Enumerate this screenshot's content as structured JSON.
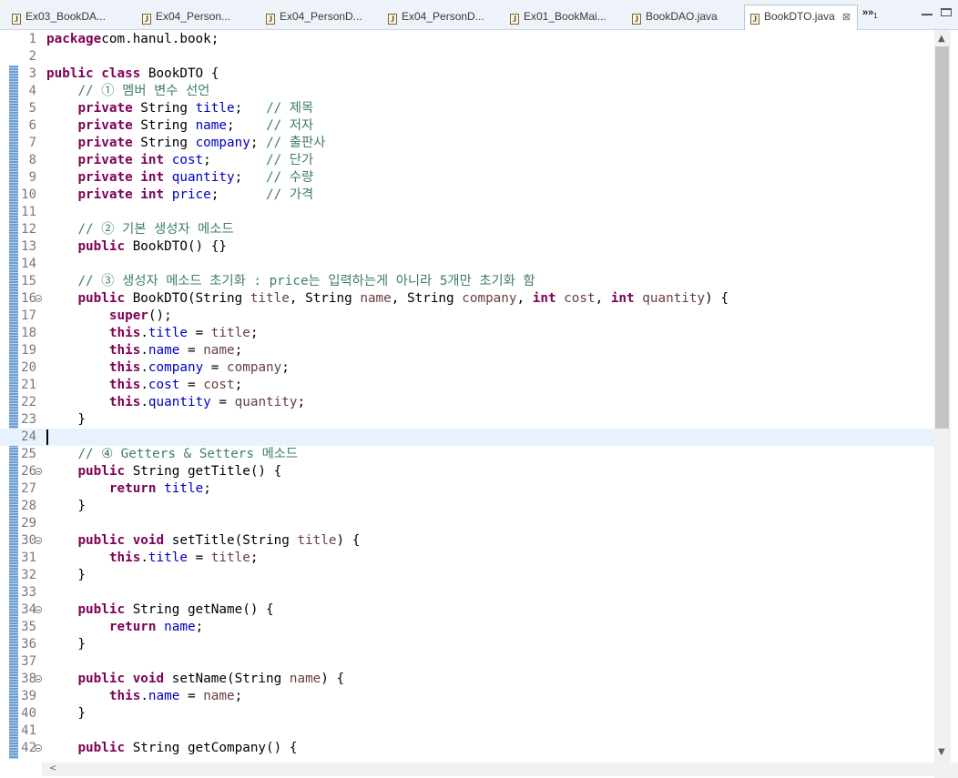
{
  "tabs": [
    {
      "label": "Ex03_BookDA...",
      "active": false
    },
    {
      "label": "Ex04_Person...",
      "active": false
    },
    {
      "label": "Ex04_PersonD...",
      "active": false
    },
    {
      "label": "Ex04_PersonD...",
      "active": false
    },
    {
      "label": "Ex01_BookMai...",
      "active": false
    },
    {
      "label": "BookDAO.java",
      "active": false
    },
    {
      "label": "BookDTO.java",
      "active": true
    }
  ],
  "tab_overflow": {
    "symbol": "»",
    "count": "1"
  },
  "icons": {
    "file": "java-file-icon",
    "close": "close-x-icon",
    "fold": "fold-collapse-icon"
  },
  "editor": {
    "current_line": 24,
    "lines": [
      {
        "n": "1",
        "t": [
          [
            "kw",
            "package"
          ],
          [
            "",
            "com.hanul.book;"
          ]
        ]
      },
      {
        "n": "2",
        "t": []
      },
      {
        "n": "3",
        "t": [
          [
            "kw",
            "public class"
          ],
          [
            "",
            " BookDTO {"
          ]
        ]
      },
      {
        "n": "4",
        "t": [
          [
            "",
            "    "
          ],
          [
            "cmt",
            "// ① 멤버 변수 선언"
          ]
        ]
      },
      {
        "n": "5",
        "t": [
          [
            "",
            "    "
          ],
          [
            "kw",
            "private"
          ],
          [
            "",
            " String "
          ],
          [
            "fld",
            "title"
          ],
          [
            "",
            ";   "
          ],
          [
            "cmt",
            "// 제목"
          ]
        ]
      },
      {
        "n": "6",
        "t": [
          [
            "",
            "    "
          ],
          [
            "kw",
            "private"
          ],
          [
            "",
            " String "
          ],
          [
            "fld",
            "name"
          ],
          [
            "",
            ";    "
          ],
          [
            "cmt",
            "// 저자"
          ]
        ]
      },
      {
        "n": "7",
        "t": [
          [
            "",
            "    "
          ],
          [
            "kw",
            "private"
          ],
          [
            "",
            " String "
          ],
          [
            "fld",
            "company"
          ],
          [
            "",
            "; "
          ],
          [
            "cmt",
            "// 출판사"
          ]
        ]
      },
      {
        "n": "8",
        "t": [
          [
            "",
            "    "
          ],
          [
            "kw",
            "private int"
          ],
          [
            "",
            " "
          ],
          [
            "fld",
            "cost"
          ],
          [
            "",
            ";       "
          ],
          [
            "cmt",
            "// 단가"
          ]
        ]
      },
      {
        "n": "9",
        "t": [
          [
            "",
            "    "
          ],
          [
            "kw",
            "private int"
          ],
          [
            "",
            " "
          ],
          [
            "fld",
            "quantity"
          ],
          [
            "",
            ";   "
          ],
          [
            "cmt",
            "// 수량"
          ]
        ]
      },
      {
        "n": "10",
        "t": [
          [
            "",
            "    "
          ],
          [
            "kw",
            "private int"
          ],
          [
            "",
            " "
          ],
          [
            "fld",
            "price"
          ],
          [
            "",
            ";      "
          ],
          [
            "cmt",
            "// 가격"
          ]
        ]
      },
      {
        "n": "11",
        "t": []
      },
      {
        "n": "12",
        "t": [
          [
            "",
            "    "
          ],
          [
            "cmt",
            "// ② 기본 생성자 메소드"
          ]
        ]
      },
      {
        "n": "13",
        "t": [
          [
            "",
            "    "
          ],
          [
            "kw",
            "public"
          ],
          [
            "",
            " BookDTO() {}"
          ]
        ]
      },
      {
        "n": "14",
        "t": []
      },
      {
        "n": "15",
        "t": [
          [
            "",
            "    "
          ],
          [
            "cmt",
            "// ③ 생성자 메소드 초기화 : price는 입력하는게 아니라 5개만 초기화 함"
          ]
        ]
      },
      {
        "n": "16",
        "fold": true,
        "t": [
          [
            "",
            "    "
          ],
          [
            "kw",
            "public"
          ],
          [
            "",
            " BookDTO(String "
          ],
          [
            "param",
            "title"
          ],
          [
            "",
            ", String "
          ],
          [
            "param",
            "name"
          ],
          [
            "",
            ", String "
          ],
          [
            "param",
            "company"
          ],
          [
            "",
            ", "
          ],
          [
            "kw",
            "int"
          ],
          [
            "",
            " "
          ],
          [
            "param",
            "cost"
          ],
          [
            "",
            ", "
          ],
          [
            "kw",
            "int"
          ],
          [
            "",
            " "
          ],
          [
            "param",
            "quantity"
          ],
          [
            "",
            ") {"
          ]
        ]
      },
      {
        "n": "17",
        "t": [
          [
            "",
            "        "
          ],
          [
            "kw",
            "super"
          ],
          [
            "",
            "();"
          ]
        ]
      },
      {
        "n": "18",
        "t": [
          [
            "",
            "        "
          ],
          [
            "kw",
            "this"
          ],
          [
            "",
            "."
          ],
          [
            "fld",
            "title"
          ],
          [
            "",
            " = "
          ],
          [
            "param",
            "title"
          ],
          [
            "",
            ";"
          ]
        ]
      },
      {
        "n": "19",
        "t": [
          [
            "",
            "        "
          ],
          [
            "kw",
            "this"
          ],
          [
            "",
            "."
          ],
          [
            "fld",
            "name"
          ],
          [
            "",
            " = "
          ],
          [
            "param",
            "name"
          ],
          [
            "",
            ";"
          ]
        ]
      },
      {
        "n": "20",
        "t": [
          [
            "",
            "        "
          ],
          [
            "kw",
            "this"
          ],
          [
            "",
            "."
          ],
          [
            "fld",
            "company"
          ],
          [
            "",
            " = "
          ],
          [
            "param",
            "company"
          ],
          [
            "",
            ";"
          ]
        ]
      },
      {
        "n": "21",
        "t": [
          [
            "",
            "        "
          ],
          [
            "kw",
            "this"
          ],
          [
            "",
            "."
          ],
          [
            "fld",
            "cost"
          ],
          [
            "",
            " = "
          ],
          [
            "param",
            "cost"
          ],
          [
            "",
            ";"
          ]
        ]
      },
      {
        "n": "22",
        "t": [
          [
            "",
            "        "
          ],
          [
            "kw",
            "this"
          ],
          [
            "",
            "."
          ],
          [
            "fld",
            "quantity"
          ],
          [
            "",
            " = "
          ],
          [
            "param",
            "quantity"
          ],
          [
            "",
            ";"
          ]
        ]
      },
      {
        "n": "23",
        "t": [
          [
            "",
            "    }"
          ]
        ]
      },
      {
        "n": "24",
        "t": []
      },
      {
        "n": "25",
        "t": [
          [
            "",
            "    "
          ],
          [
            "cmt",
            "// ④ Getters & Setters 메소드"
          ]
        ]
      },
      {
        "n": "26",
        "fold": true,
        "t": [
          [
            "",
            "    "
          ],
          [
            "kw",
            "public"
          ],
          [
            "",
            " String getTitle() {"
          ]
        ]
      },
      {
        "n": "27",
        "t": [
          [
            "",
            "        "
          ],
          [
            "kw",
            "return"
          ],
          [
            "",
            " "
          ],
          [
            "fld",
            "title"
          ],
          [
            "",
            ";"
          ]
        ]
      },
      {
        "n": "28",
        "t": [
          [
            "",
            "    }"
          ]
        ]
      },
      {
        "n": "29",
        "t": []
      },
      {
        "n": "30",
        "fold": true,
        "t": [
          [
            "",
            "    "
          ],
          [
            "kw",
            "public void"
          ],
          [
            "",
            " setTitle(String "
          ],
          [
            "param",
            "title"
          ],
          [
            "",
            ") {"
          ]
        ]
      },
      {
        "n": "31",
        "t": [
          [
            "",
            "        "
          ],
          [
            "kw",
            "this"
          ],
          [
            "",
            "."
          ],
          [
            "fld",
            "title"
          ],
          [
            "",
            " = "
          ],
          [
            "param",
            "title"
          ],
          [
            "",
            ";"
          ]
        ]
      },
      {
        "n": "32",
        "t": [
          [
            "",
            "    }"
          ]
        ]
      },
      {
        "n": "33",
        "t": []
      },
      {
        "n": "34",
        "fold": true,
        "t": [
          [
            "",
            "    "
          ],
          [
            "kw",
            "public"
          ],
          [
            "",
            " String getName() {"
          ]
        ]
      },
      {
        "n": "35",
        "t": [
          [
            "",
            "        "
          ],
          [
            "kw",
            "return"
          ],
          [
            "",
            " "
          ],
          [
            "fld",
            "name"
          ],
          [
            "",
            ";"
          ]
        ]
      },
      {
        "n": "36",
        "t": [
          [
            "",
            "    }"
          ]
        ]
      },
      {
        "n": "37",
        "t": []
      },
      {
        "n": "38",
        "fold": true,
        "t": [
          [
            "",
            "    "
          ],
          [
            "kw",
            "public void"
          ],
          [
            "",
            " setName(String "
          ],
          [
            "param",
            "name"
          ],
          [
            "",
            ") {"
          ]
        ]
      },
      {
        "n": "39",
        "t": [
          [
            "",
            "        "
          ],
          [
            "kw",
            "this"
          ],
          [
            "",
            "."
          ],
          [
            "fld",
            "name"
          ],
          [
            "",
            " = "
          ],
          [
            "param",
            "name"
          ],
          [
            "",
            ";"
          ]
        ]
      },
      {
        "n": "40",
        "t": [
          [
            "",
            "    }"
          ]
        ]
      },
      {
        "n": "41",
        "t": []
      },
      {
        "n": "42",
        "fold": true,
        "t": [
          [
            "",
            "    "
          ],
          [
            "kw",
            "public"
          ],
          [
            "",
            " String getCompany() {"
          ]
        ]
      }
    ]
  },
  "scrollbar": {
    "up": "▲",
    "down": "▼",
    "left": "<"
  }
}
